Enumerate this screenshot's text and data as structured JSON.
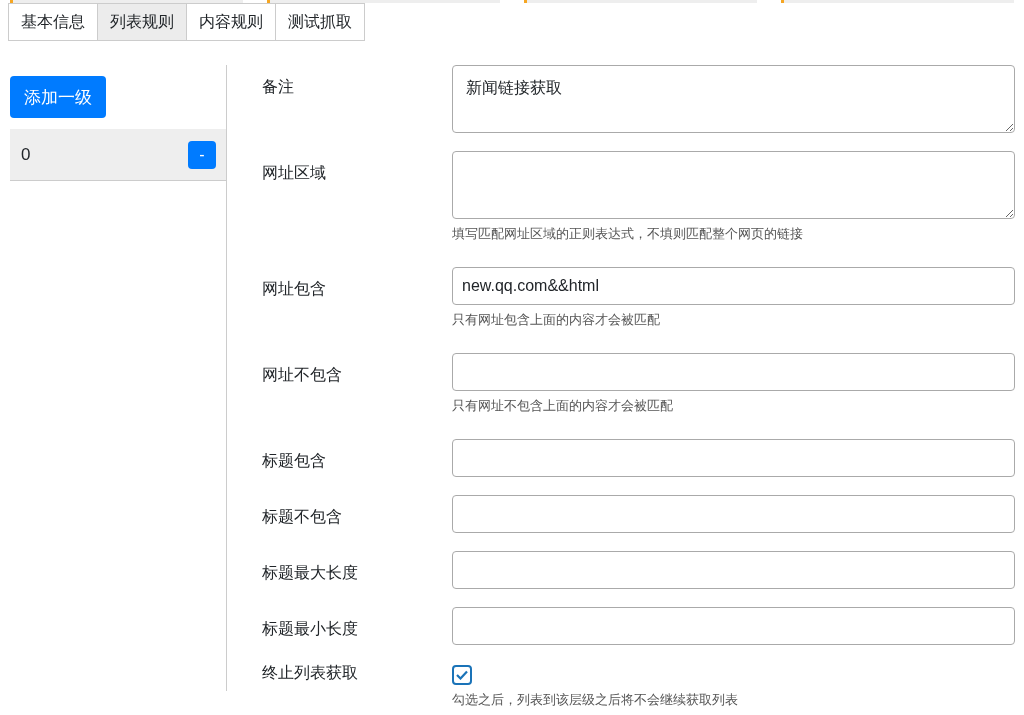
{
  "tabs": [
    {
      "label": "基本信息",
      "selected": false
    },
    {
      "label": "列表规则",
      "selected": true
    },
    {
      "label": "内容规则",
      "selected": false
    },
    {
      "label": "测试抓取",
      "selected": false
    }
  ],
  "sidebar": {
    "add_button": "添加一级",
    "levels": [
      {
        "label": "0",
        "remove_button": "-",
        "selected": true
      }
    ]
  },
  "fields": [
    {
      "kind": "textarea",
      "label": "备注",
      "value": "新闻链接获取"
    },
    {
      "kind": "textarea",
      "label": "网址区域",
      "hint": "填写匹配网址区域的正则表达式，不填则匹配整个网页的链接"
    },
    {
      "kind": "input",
      "label": "网址包含",
      "value": "new.qq.com&&html",
      "hint": "只有网址包含上面的内容才会被匹配"
    },
    {
      "kind": "input",
      "label": "网址不包含",
      "hint": "只有网址不包含上面的内容才会被匹配"
    },
    {
      "kind": "input",
      "label": "标题包含"
    },
    {
      "kind": "input",
      "label": "标题不包含"
    },
    {
      "kind": "input",
      "label": "标题最大长度"
    },
    {
      "kind": "input",
      "label": "标题最小长度"
    },
    {
      "kind": "checkbox",
      "label": "终止列表获取",
      "checked": true,
      "hint": "勾选之后，列表到该层级之后将不会继续获取列表"
    }
  ]
}
